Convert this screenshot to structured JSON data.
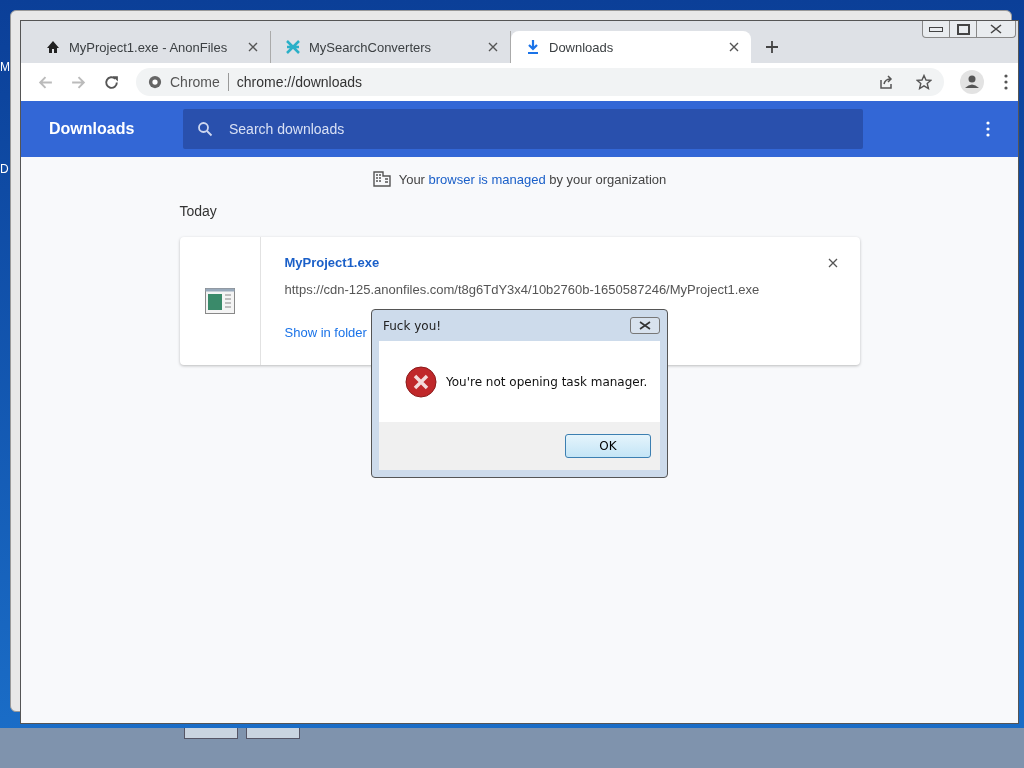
{
  "desktop": {
    "icon_labels": [
      "M",
      "D"
    ]
  },
  "tabs": [
    {
      "title": "MyProject1.exe - AnonFiles",
      "kind": "site",
      "selected": false
    },
    {
      "title": "MySearchConverters",
      "kind": "converter",
      "selected": false
    },
    {
      "title": "Downloads",
      "kind": "download",
      "selected": true
    }
  ],
  "address_bar": {
    "origin": "Chrome",
    "url": "chrome://downloads"
  },
  "header": {
    "title": "Downloads",
    "search_placeholder": "Search downloads"
  },
  "managed_notice": {
    "before": "Your",
    "link": "browser is managed",
    "after": "by your organization"
  },
  "section": "Today",
  "downloads": [
    {
      "name": "MyProject1.exe",
      "url": "https://cdn-125.anonfiles.com/t8g6TdY3x4/10b2760b-1650587246/MyProject1.exe",
      "action": "Show in folder"
    }
  ],
  "dialog": {
    "title": "Fuck you!",
    "message": "You're not opening task manager.",
    "button": "OK"
  }
}
